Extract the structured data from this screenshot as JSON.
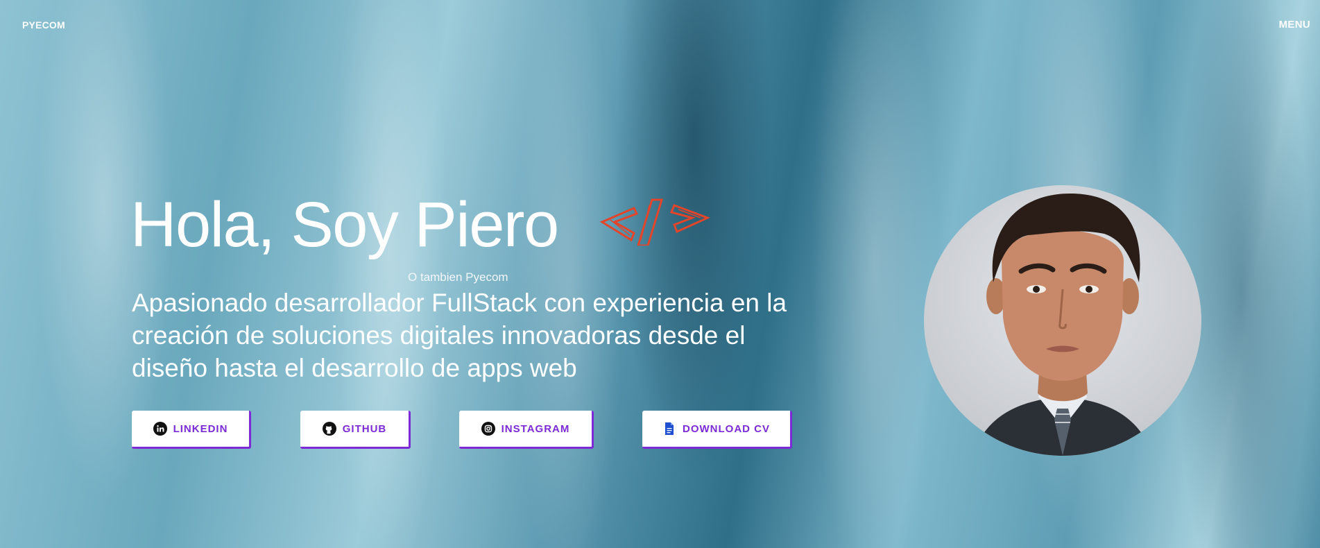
{
  "nav": {
    "brand": "PYECOM",
    "menu": "MENU"
  },
  "hero": {
    "title": "Hola, Soy Piero",
    "subtitle": "O tambien Pyecom",
    "description": "Apasionado desarrollador FullStack con experiencia en la creación de soluciones digitales innovadoras desde el diseño hasta el desarrollo de apps web"
  },
  "buttons": [
    {
      "label": "LINKEDIN",
      "icon": "linkedin-icon"
    },
    {
      "label": "GITHUB",
      "icon": "github-icon"
    },
    {
      "label": "INSTAGRAM",
      "icon": "instagram-icon"
    },
    {
      "label": "DOWNLOAD CV",
      "icon": "document-icon"
    }
  ],
  "colors": {
    "accent": "#7b2ad6",
    "code_icon": "#e2452a"
  }
}
